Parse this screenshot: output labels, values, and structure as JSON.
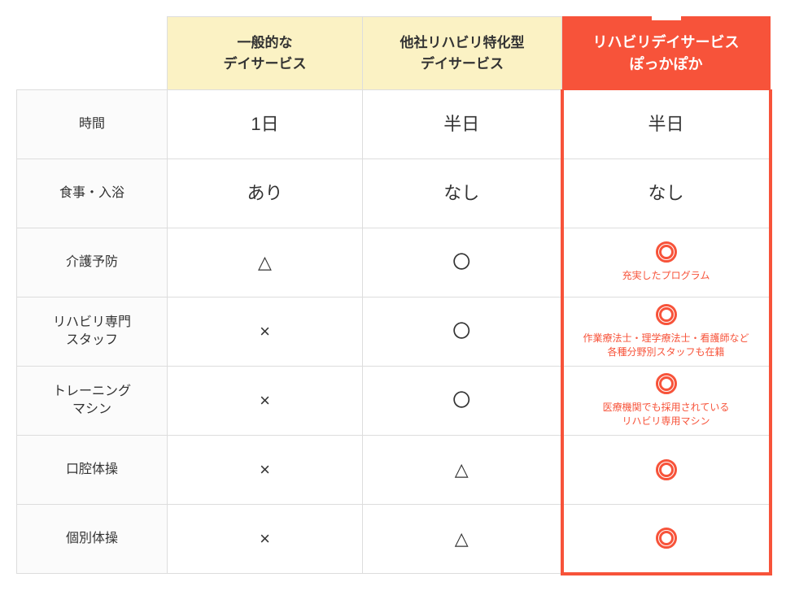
{
  "headers": {
    "col1_line1": "一般的な",
    "col1_line2": "デイサービス",
    "col2_line1": "他社リハビリ特化型",
    "col2_line2": "デイサービス",
    "col3_line1": "リハビリデイサービス",
    "col3_line2": "ぽっかぽか"
  },
  "rows": [
    {
      "label": "時間",
      "c1": "1日",
      "c2": "半日",
      "c3": {
        "type": "text",
        "value": "半日"
      }
    },
    {
      "label": "食事・入浴",
      "c1": "あり",
      "c2": "なし",
      "c3": {
        "type": "text",
        "value": "なし"
      }
    },
    {
      "label": "介護予防",
      "c1": "△",
      "c2": "〇",
      "c3": {
        "type": "double",
        "note": "充実したプログラム"
      }
    },
    {
      "label_line1": "リハビリ専門",
      "label_line2": "スタッフ",
      "c1": "×",
      "c2": "〇",
      "c3": {
        "type": "double",
        "note_line1": "作業療法士・理学療法士・看護師など",
        "note_line2": "各種分野別スタッフも在籍"
      }
    },
    {
      "label_line1": "トレーニング",
      "label_line2": "マシン",
      "c1": "×",
      "c2": "〇",
      "c3": {
        "type": "double",
        "note_line1": "医療機関でも採用されている",
        "note_line2": "リハビリ専用マシン"
      }
    },
    {
      "label": "口腔体操",
      "c1": "×",
      "c2": "△",
      "c3": {
        "type": "double"
      }
    },
    {
      "label": "個別体操",
      "c1": "×",
      "c2": "△",
      "c3": {
        "type": "double"
      }
    }
  ],
  "chart_data": {
    "type": "table",
    "columns": [
      "一般的なデイサービス",
      "他社リハビリ特化型デイサービス",
      "リハビリデイサービス ぽっかぽか"
    ],
    "rows": [
      {
        "label": "時間",
        "values": [
          "1日",
          "半日",
          "半日"
        ]
      },
      {
        "label": "食事・入浴",
        "values": [
          "あり",
          "なし",
          "なし"
        ]
      },
      {
        "label": "介護予防",
        "values": [
          "△",
          "〇",
          "◎ 充実したプログラム"
        ]
      },
      {
        "label": "リハビリ専門スタッフ",
        "values": [
          "×",
          "〇",
          "◎ 作業療法士・理学療法士・看護師など各種分野別スタッフも在籍"
        ]
      },
      {
        "label": "トレーニングマシン",
        "values": [
          "×",
          "〇",
          "◎ 医療機関でも採用されているリハビリ専用マシン"
        ]
      },
      {
        "label": "口腔体操",
        "values": [
          "×",
          "△",
          "◎"
        ]
      },
      {
        "label": "個別体操",
        "values": [
          "×",
          "△",
          "◎"
        ]
      }
    ]
  }
}
